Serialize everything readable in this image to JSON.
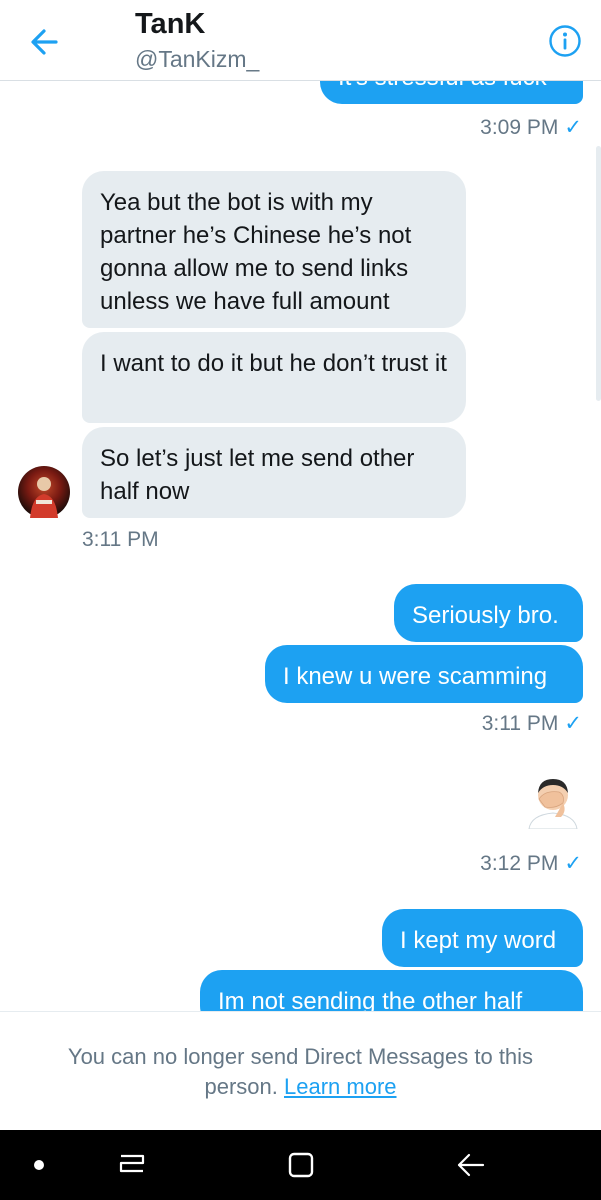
{
  "header": {
    "title": "TanK",
    "handle": "@TanKizm_",
    "back_icon": "arrow-left-icon",
    "info_icon": "info-circle-icon"
  },
  "colors": {
    "accent": "#1da1f2",
    "incoming_bubble": "#e6ecf0",
    "secondary_text": "#657786"
  },
  "messages": {
    "m0_partial": "It's stressful as fuck",
    "t1": "3:09 PM",
    "in1": "Yea but the bot is with my partner he’s Chinese he’s not gonna allow me to send links unless we have full amount",
    "in2": "I want to do it but he don’t trust it",
    "in3": "So let’s just let me send other half now",
    "t2": "3:11 PM",
    "out1": "Seriously bro.",
    "out2": "I knew u were scamming",
    "t3": "3:11 PM",
    "emoji_name": "face-palm-emoji",
    "t4": "3:12 PM",
    "out3": "I kept my word",
    "out4": "Im not sending the other half",
    "check": "✓"
  },
  "footer": {
    "text": "You can no longer send Direct Messages to this person.",
    "link": "Learn more"
  },
  "navbar": {
    "icons": [
      "dot-icon",
      "recent-apps-icon",
      "home-icon",
      "back-icon"
    ]
  }
}
